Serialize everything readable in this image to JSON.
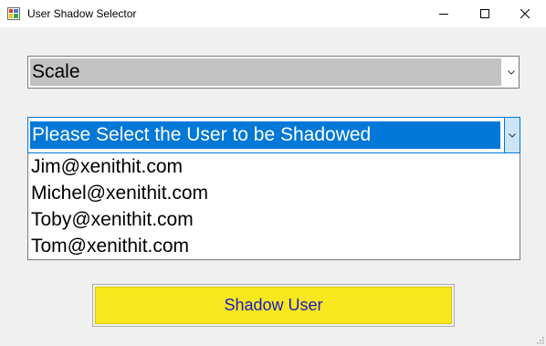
{
  "window": {
    "title": "User Shadow Selector",
    "controls": {
      "minimize": "minimize-icon",
      "maximize": "maximize-icon",
      "close": "close-icon"
    }
  },
  "scale_combo": {
    "selected": "Scale"
  },
  "user_combo": {
    "selected": "Please Select the User to be Shadowed",
    "options": [
      "Jim@xenithit.com",
      "Michel@xenithit.com",
      "Toby@xenithit.com",
      "Tom@xenithit.com"
    ]
  },
  "actions": {
    "shadow_label": "Shadow User"
  },
  "colors": {
    "selection": "#0078d7",
    "button_bg": "#f8e71c",
    "button_text": "#1a1acd",
    "scale_bg": "#c2c2c2"
  }
}
